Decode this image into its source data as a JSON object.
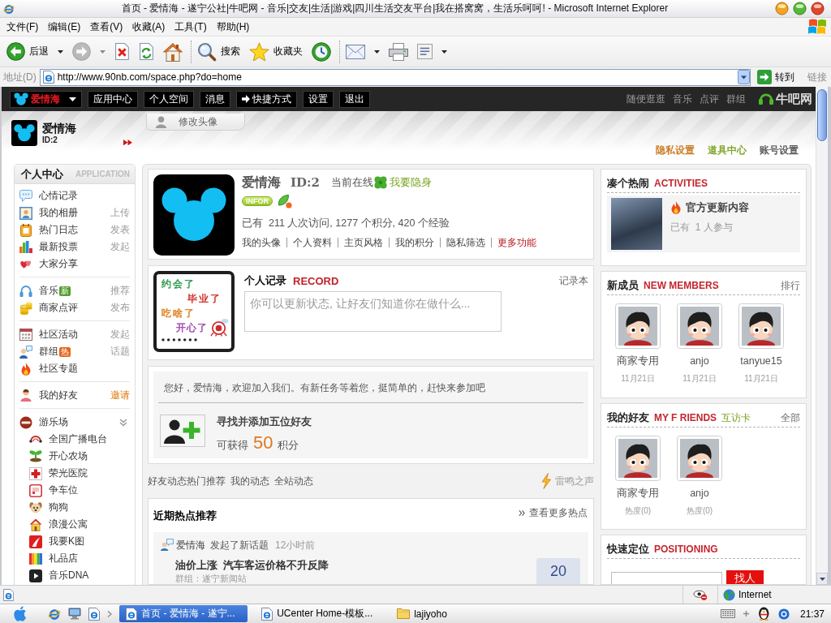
{
  "window": {
    "title": "首页 - 爱情海 - 遂宁公社|牛吧网 - 音乐|交友|生活|游戏|四川生活交友平台|我在搭窝窝，生活乐呵呵! - Microsoft Internet Explorer"
  },
  "menu_bar": [
    "文件(F)",
    "编辑(E)",
    "查看(V)",
    "收藏(A)",
    "工具(T)",
    "帮助(H)"
  ],
  "toolbar": [
    {
      "kind": "back",
      "label": "后退",
      "disabled": false,
      "dropdown": true
    },
    {
      "kind": "forward",
      "disabled": true,
      "dropdown": true
    },
    {
      "kind": "stop",
      "disabled": false,
      "dropdown": false
    },
    {
      "kind": "refresh",
      "disabled": false,
      "dropdown": false
    },
    {
      "kind": "home",
      "disabled": false,
      "dropdown": false
    },
    {
      "kind": "separator"
    },
    {
      "kind": "search",
      "label": "搜索",
      "disabled": false,
      "dropdown": false
    },
    {
      "kind": "favorites",
      "label": "收藏夹",
      "disabled": false,
      "dropdown": false
    },
    {
      "kind": "history",
      "disabled": false,
      "dropdown": false
    },
    {
      "kind": "separator"
    },
    {
      "kind": "mail",
      "disabled": false,
      "dropdown": true
    },
    {
      "kind": "print",
      "disabled": false,
      "dropdown": false
    },
    {
      "kind": "edit",
      "disabled": false,
      "dropdown": true
    }
  ],
  "address_bar": {
    "label": "地址(D)",
    "url": "http://www.90nb.com/space.php?do=home",
    "go": "转到",
    "links": "链接"
  },
  "site_nav": {
    "logo": "爱情海",
    "items": [
      {
        "label": "应用中心",
        "kind": "plain"
      },
      {
        "label": "个人空间",
        "kind": "plain"
      },
      {
        "label": "消息",
        "kind": "plain"
      },
      {
        "label": "快捷方式",
        "kind": "arrow"
      },
      {
        "label": "设置",
        "kind": "plain"
      },
      {
        "label": "退出",
        "kind": "plain"
      }
    ],
    "links": [
      "随便逛逛",
      "音乐",
      "点评",
      "群组"
    ],
    "brand": "牛吧网"
  },
  "header": {
    "name": "爱情海",
    "id": "ID:2",
    "tab": "修改头像",
    "links": [
      {
        "label": "隐私设置",
        "color": "#c8781e"
      },
      {
        "label": "道具中心",
        "color": "#79a01e"
      },
      {
        "label": "账号设置",
        "color": "#555555"
      }
    ]
  },
  "sidebar": {
    "title": "个人中心",
    "subtitle": "APPLICATION",
    "groups": [
      {
        "items": [
          {
            "label": "心情记录"
          },
          {
            "label": "我的相册",
            "action": "上传",
            "action_highlight": false
          },
          {
            "label": "热门日志",
            "action": "发表",
            "action_highlight": false
          },
          {
            "label": "最新投票",
            "action": "发起",
            "action_highlight": false
          },
          {
            "label": "大家分享"
          }
        ]
      },
      {
        "items": [
          {
            "label": "音乐",
            "badge": {
              "text": "新",
              "color": "#4f9e2c"
            },
            "action": "推荐",
            "action_highlight": false
          },
          {
            "label": "商家点评",
            "action": "发布",
            "action_highlight": false
          }
        ]
      },
      {
        "items": [
          {
            "label": "社区活动",
            "action": "发起",
            "action_highlight": false
          },
          {
            "label": "群组",
            "badge": {
              "text": "热",
              "color": "#e8641e"
            },
            "action": "话题",
            "action_highlight": false
          },
          {
            "label": "社区专题"
          }
        ]
      },
      {
        "items": [
          {
            "label": "我的好友",
            "action": "邀请",
            "action_highlight": true
          }
        ]
      },
      {
        "items": [
          {
            "label": "游乐场",
            "expanded": true,
            "children": [
              {
                "label": "全国广播电台"
              },
              {
                "label": "开心农场"
              },
              {
                "label": "荣光医院"
              },
              {
                "label": "争车位"
              },
              {
                "label": "狗狗"
              },
              {
                "label": "浪漫公寓"
              },
              {
                "label": "我要K图"
              },
              {
                "label": "礼品店"
              },
              {
                "label": "音乐DNA"
              }
            ]
          }
        ]
      }
    ]
  },
  "profile": {
    "name": "爱情海",
    "id": "ID:2",
    "status": "当前在线",
    "hide_link": "我要隐身",
    "badge": "INFOR",
    "stats": "已有  211 人次访问, 1277 个积分, 420 个经验",
    "links": [
      {
        "label": "我的头像",
        "highlight": false
      },
      {
        "label": "个人资料",
        "highlight": false
      },
      {
        "label": "主页风格",
        "highlight": false
      },
      {
        "label": "我的积分",
        "highlight": false
      },
      {
        "label": "隐私筛选",
        "highlight": false
      },
      {
        "label": "更多功能",
        "highlight": true
      }
    ]
  },
  "record": {
    "title": "个人记录",
    "title_en": "RECORD",
    "notebook": "记录本",
    "placeholder": "你可以更新状态, 让好友们知道你在做什么...",
    "picture_lines": [
      {
        "text": "约会了",
        "color": "#2f9a4c"
      },
      {
        "text": "毕业了",
        "color": "#d0302a"
      },
      {
        "text": "吃啥了",
        "color": "#e08428"
      },
      {
        "text": "开心了",
        "color": "#a04cae"
      }
    ]
  },
  "task": {
    "greeting": "您好，爱情海，欢迎加入我们。有新任务等着您，挺简单的，赶快来参加吧",
    "title": "寻找并添加五位好友",
    "reward_prefix": "可获得",
    "reward": "50",
    "reward_suffix": "积分"
  },
  "feed": {
    "tabs": [
      "好友动态",
      "热门推荐",
      "我的动态",
      "全站动态"
    ],
    "side_link": "雷鸣之声"
  },
  "hot": {
    "title": "近期热点推荐",
    "more": "查看更多热点",
    "items": [
      {
        "user": "爱情海",
        "action": "发起了新话题",
        "time": "12小时前",
        "title": "油价上涨  汽车客运价格不升反降",
        "source": "群组：遂宁新闻站",
        "count": "20"
      }
    ]
  },
  "activities": {
    "title": "凑个热闹",
    "title_en": "ACTIVITIES",
    "items": [
      {
        "title": "官方更新内容",
        "meta": "已有  1 人参与"
      }
    ]
  },
  "new_members": {
    "title": "新成员",
    "title_en": "NEW MEMBERS",
    "more": "排行",
    "members": [
      {
        "name": "商家专用",
        "date": "11月21日"
      },
      {
        "name": "anjo",
        "date": "11月21日"
      },
      {
        "name": "tanyue15",
        "date": "11月21日"
      }
    ]
  },
  "friends": {
    "title": "我的好友",
    "title_en": "MY F RIENDS",
    "extra": "互访卡",
    "more": "全部",
    "members": [
      {
        "name": "商家专用",
        "heat": "热度(0)"
      },
      {
        "name": "anjo",
        "heat": "热度(0)"
      }
    ]
  },
  "positioning": {
    "title": "快速定位",
    "title_en": "POSITIONING",
    "button": "找人"
  },
  "status_bar": {
    "zone": "Internet"
  },
  "taskbar": {
    "tasks": [
      {
        "label": "首页 - 爱情海 - 遂宁...",
        "kind": "browser",
        "selected": true
      },
      {
        "label": "UCenter Home-模板...",
        "kind": "browser",
        "selected": false
      },
      {
        "label": "lajiyoho",
        "kind": "folder",
        "selected": false
      }
    ],
    "clock": "21:37"
  }
}
